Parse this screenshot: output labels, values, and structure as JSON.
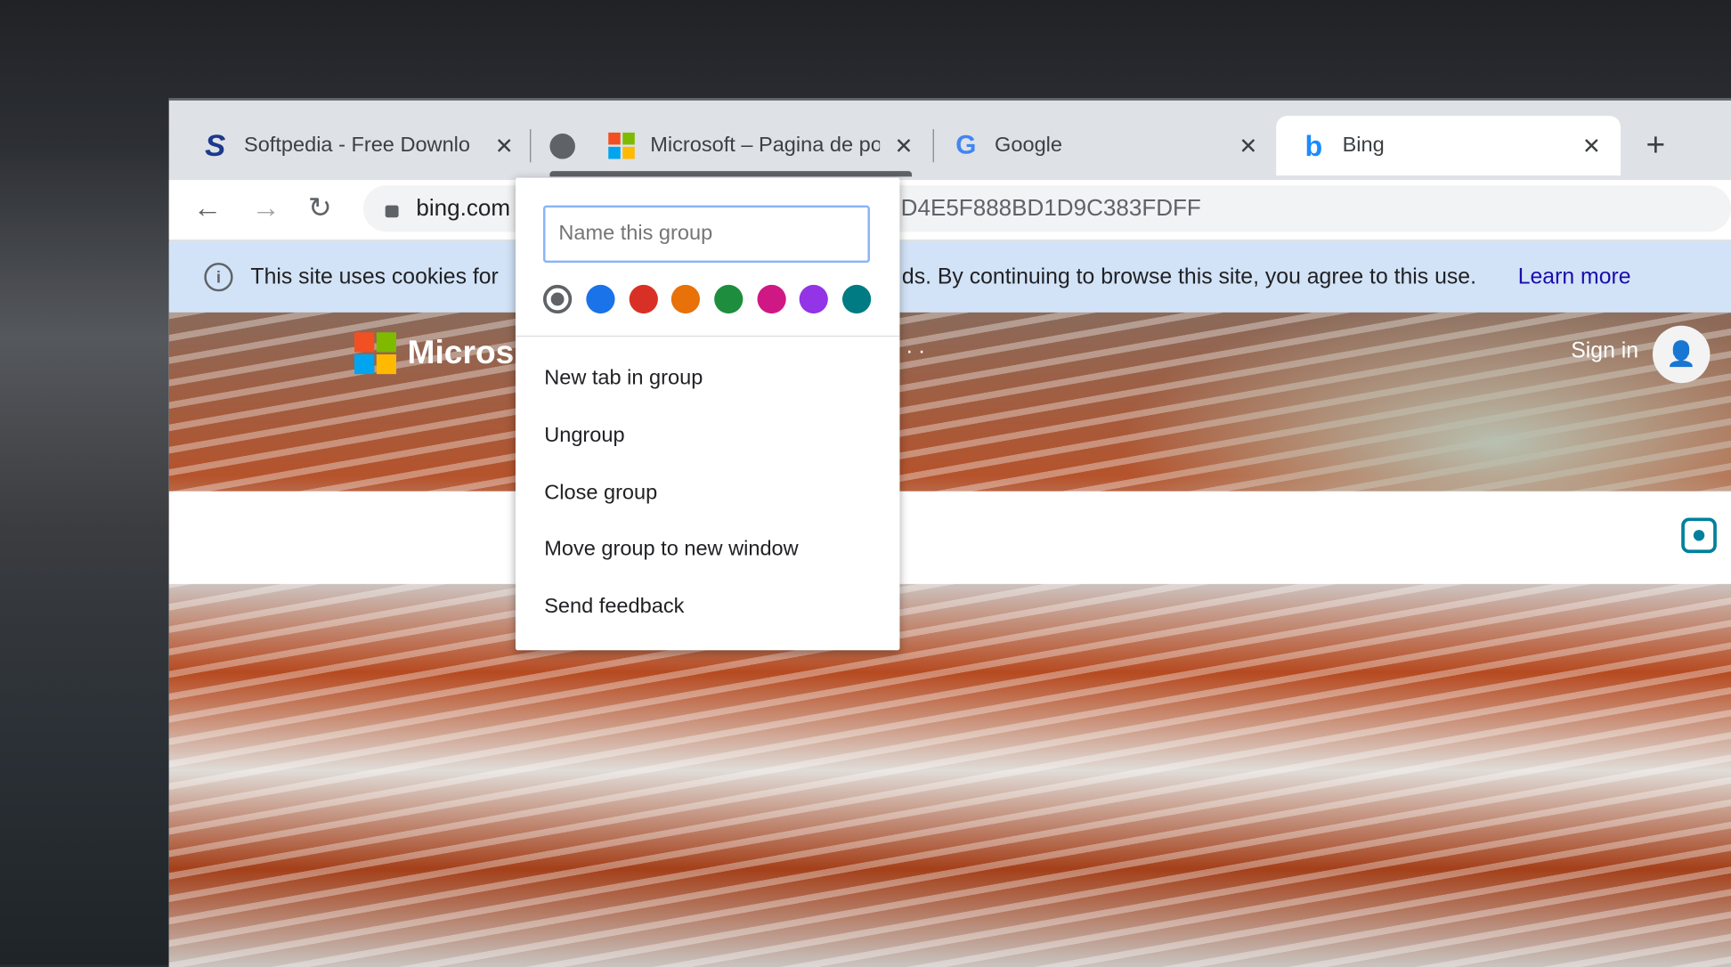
{
  "tabs": [
    {
      "title": "Softpedia - Free Downlo",
      "icon": "softpedia-icon"
    },
    {
      "title": "Microsoft – Pagina de pornire",
      "icon": "microsoft-icon"
    },
    {
      "title": "Google",
      "icon": "google-icon"
    },
    {
      "title": "Bing",
      "icon": "bing-icon",
      "active": true
    }
  ],
  "group_color": "#5f6368",
  "toolbar": {
    "url_prefix": "bing.com",
    "url_suffix": "D4E5F888BD1D9C383FDFF"
  },
  "infobar": {
    "text_start": "This site uses cookies for",
    "text_end": "ds. By continuing to browse this site, you agree to this use.",
    "link": "Learn more"
  },
  "page": {
    "brand": "Micros",
    "sign_in": "Sign in",
    "dots": ". ."
  },
  "group_menu": {
    "name_placeholder": "Name this group",
    "colors": [
      "#5f6368",
      "#1a73e8",
      "#d93025",
      "#e8710a",
      "#1e8e3e",
      "#d01884",
      "#9334e6",
      "#007b83"
    ],
    "selected_color": "#5f6368",
    "items": [
      "New tab in group",
      "Ungroup",
      "Close group",
      "Move group to new window",
      "Send feedback"
    ]
  }
}
